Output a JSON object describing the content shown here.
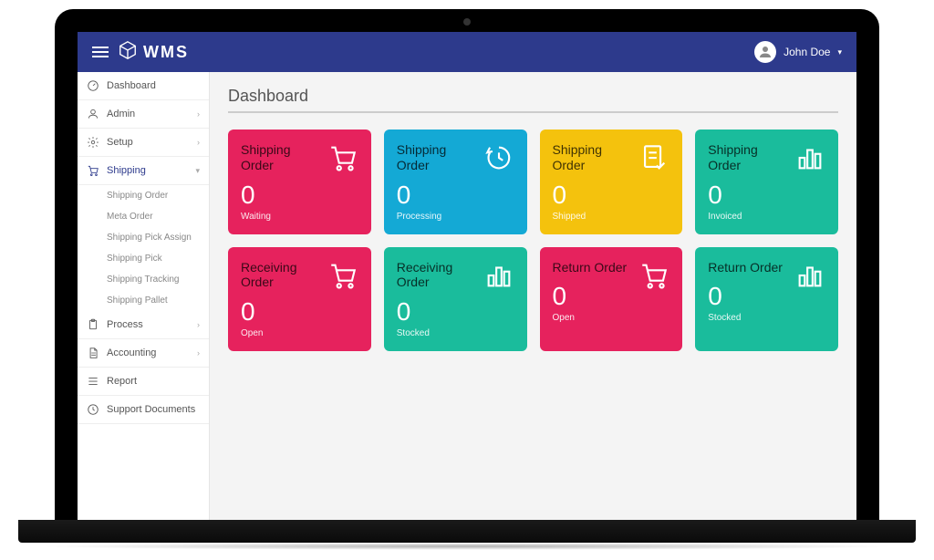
{
  "brand": "WMS",
  "user": {
    "name": "John Doe"
  },
  "page": {
    "title": "Dashboard"
  },
  "sidebar": {
    "items": [
      {
        "label": "Dashboard",
        "icon": "speedometer",
        "expandable": false
      },
      {
        "label": "Admin",
        "icon": "user",
        "expandable": true
      },
      {
        "label": "Setup",
        "icon": "gear",
        "expandable": true
      },
      {
        "label": "Shipping",
        "icon": "cart",
        "expandable": true,
        "active": true,
        "children": [
          "Shipping Order",
          "Meta Order",
          "Shipping Pick Assign",
          "Shipping Pick",
          "Shipping Tracking",
          "Shipping Pallet"
        ]
      },
      {
        "label": "Process",
        "icon": "clipboard",
        "expandable": true
      },
      {
        "label": "Accounting",
        "icon": "document",
        "expandable": true
      },
      {
        "label": "Report",
        "icon": "list",
        "expandable": false
      },
      {
        "label": "Support Documents",
        "icon": "clock",
        "expandable": false
      }
    ]
  },
  "cards": [
    {
      "title": "Shipping Order",
      "value": 0,
      "status": "Waiting",
      "color": "pink",
      "icon": "cart"
    },
    {
      "title": "Shipping Order",
      "value": 0,
      "status": "Processing",
      "color": "blue",
      "icon": "clock-arc"
    },
    {
      "title": "Shipping Order",
      "value": 0,
      "status": "Shipped",
      "color": "yellow",
      "icon": "doc-check"
    },
    {
      "title": "Shipping Order",
      "value": 0,
      "status": "Invoiced",
      "color": "green",
      "icon": "bars"
    },
    {
      "title": "Receiving Order",
      "value": 0,
      "status": "Open",
      "color": "pink",
      "icon": "cart"
    },
    {
      "title": "Receiving Order",
      "value": 0,
      "status": "Stocked",
      "color": "green",
      "icon": "bars"
    },
    {
      "title": "Return Order",
      "value": 0,
      "status": "Open",
      "color": "pink",
      "icon": "cart"
    },
    {
      "title": "Return Order",
      "value": 0,
      "status": "Stocked",
      "color": "green",
      "icon": "bars"
    }
  ]
}
